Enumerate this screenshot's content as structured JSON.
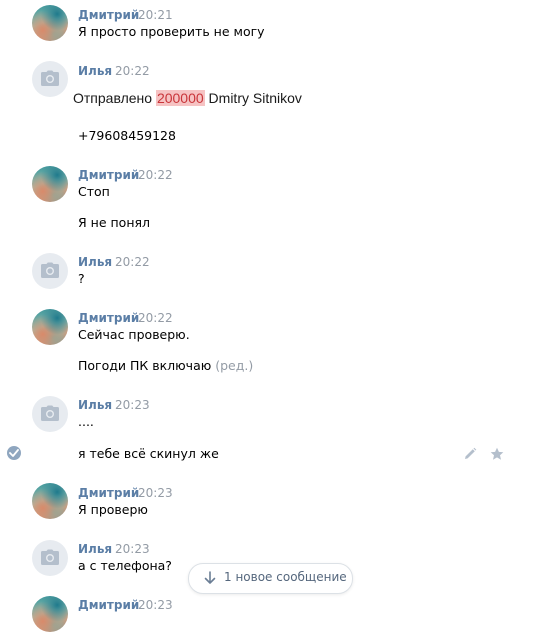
{
  "messages": [
    {
      "author": "Дмитрий",
      "time": "20:21",
      "lines": [
        "Я просто проверить не могу"
      ]
    },
    {
      "author": "Илья",
      "time": "20:22",
      "transfer": {
        "prefix": "Отправлено",
        "amount": "200000",
        "recipient": "Dmitry Sitnikov"
      },
      "lines": [
        "+79608459128"
      ]
    },
    {
      "author": "Дмитрий",
      "time": "20:22",
      "lines": [
        "Стоп",
        "Я не понял"
      ]
    },
    {
      "author": "Илья",
      "time": "20:22",
      "lines": [
        "?"
      ]
    },
    {
      "author": "Дмитрий",
      "time": "20:22",
      "lines": [
        "Сейчас проверю.",
        "Погоди ПК включаю"
      ],
      "edited_mark": "(ред.)"
    },
    {
      "author": "Илья",
      "time": "20:23",
      "lines": [
        "....",
        "я тебе всё скинул же"
      ]
    },
    {
      "author": "Дмитрий",
      "time": "20:23",
      "lines": [
        "Я проверю"
      ]
    },
    {
      "author": "Илья",
      "time": "20:23",
      "lines": [
        "а с телефона?"
      ]
    },
    {
      "author": "Дмитрий",
      "time": "20:23",
      "lines": []
    }
  ],
  "new_messages_button": {
    "label": "1 новое сообщение"
  },
  "icons": {
    "camera_avatar": "camera-icon",
    "selected": "check-icon",
    "edit": "pencil-icon",
    "favorite": "star-icon",
    "scroll_down": "arrow-down-icon"
  },
  "colors": {
    "author": "#5b7ea6",
    "time": "#939ba5",
    "highlight_bg": "#f6c3c3",
    "highlight_text": "#c9353a"
  }
}
